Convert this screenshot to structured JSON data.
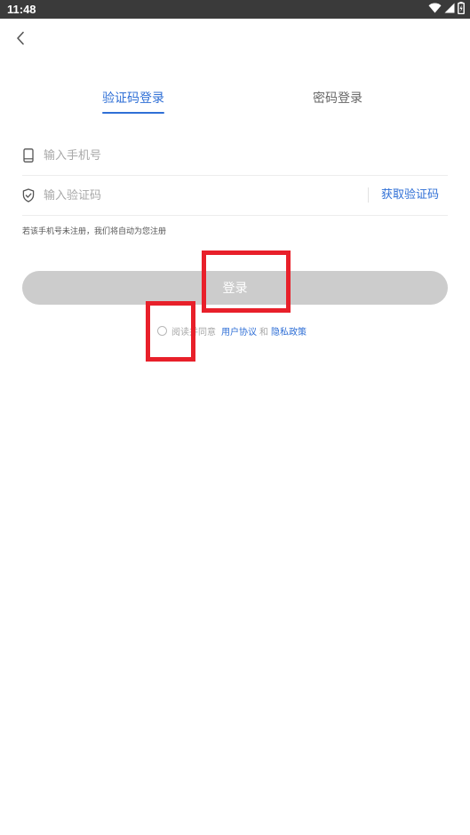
{
  "status_bar": {
    "time": "11:48",
    "icons": [
      "wifi-icon",
      "cell-signal-icon",
      "battery-icon"
    ]
  },
  "nav": {
    "back_icon": "chevron-left-icon"
  },
  "tabs": [
    {
      "label": "验证码登录",
      "active": true
    },
    {
      "label": "密码登录",
      "active": false
    }
  ],
  "form": {
    "phone": {
      "icon": "phone-icon",
      "placeholder": "输入手机号",
      "value": ""
    },
    "code": {
      "icon": "shield-icon",
      "placeholder": "输入验证码",
      "value": "",
      "get_code_label": "获取验证码"
    },
    "hint": "若该手机号未注册，我们将自动为您注册"
  },
  "login_button": {
    "label": "登录"
  },
  "agreement": {
    "checked": false,
    "prefix": "阅读并同意",
    "user_agreement": "用户协议",
    "and": "和",
    "privacy_policy": "隐私政策"
  },
  "colors": {
    "accent": "#2f6fd6",
    "button_disabled": "#cccccc",
    "status_bar": "#3a3a3a",
    "highlight": "#e8202a"
  }
}
